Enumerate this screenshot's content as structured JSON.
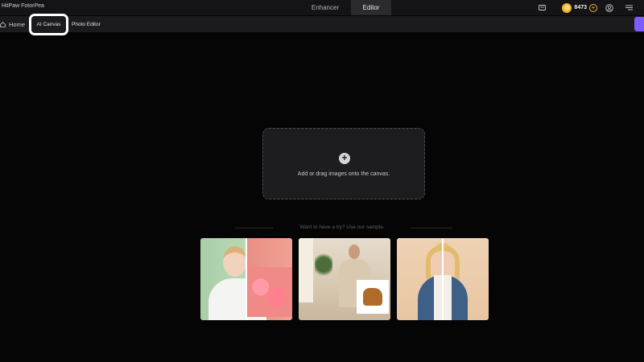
{
  "window": {
    "title": "HitPaw FotorPea"
  },
  "top_tabs": [
    {
      "label": "Enhancer",
      "active": false
    },
    {
      "label": "Editor",
      "active": true
    }
  ],
  "toolbar_right": {
    "credits": "8473",
    "icons": [
      "feedback-icon",
      "coin-icon",
      "add-credits-icon",
      "account-icon",
      "menu-icon"
    ]
  },
  "subnav": {
    "home": "Home",
    "ai_canvas": "AI Canvas",
    "photo_editor": "Photo Editor"
  },
  "canvas": {
    "drop_text": "Add or drag images onto the canvas.",
    "sample_label": "Want to have a try? Use our sample."
  },
  "colors": {
    "accent": "#7a5cff",
    "coin": "#f2b233",
    "background": "#050505"
  }
}
